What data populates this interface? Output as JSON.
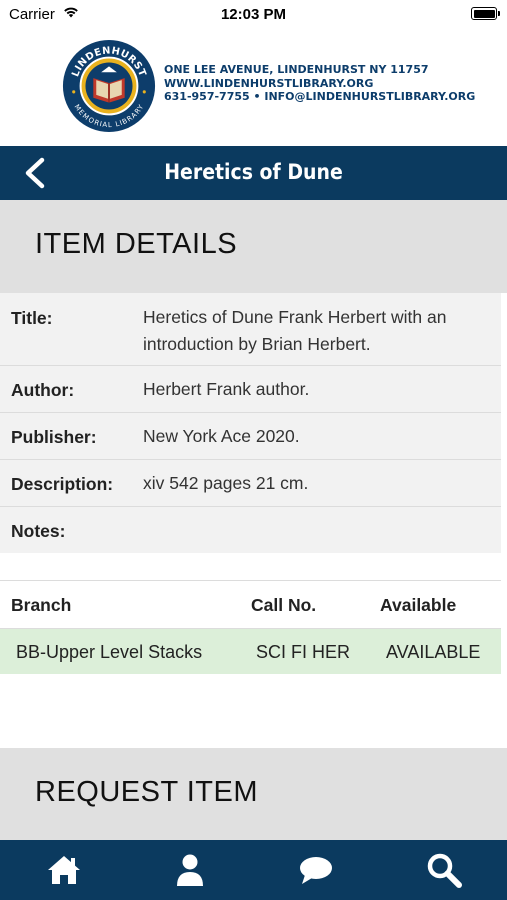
{
  "status_bar": {
    "carrier": "Carrier",
    "time": "12:03 PM"
  },
  "library": {
    "logo_text_top": "LINDENHURST",
    "logo_text_bottom": "MEMORIAL LIBRARY",
    "address": "ONE LEE AVENUE, LINDENHURST NY 11757",
    "website": "WWW.LINDENHURSTLIBRARY.ORG",
    "contact": "631-957-7755 • INFO@LINDENHURSTLIBRARY.ORG"
  },
  "navbar": {
    "title": "Heretics of Dune"
  },
  "item_details": {
    "heading": "ITEM DETAILS",
    "rows": [
      {
        "label": "Title:",
        "value": "Heretics of Dune Frank Herbert with an introduction by Brian Herbert."
      },
      {
        "label": "Author:",
        "value": "Herbert Frank author."
      },
      {
        "label": "Publisher:",
        "value": "New York Ace 2020."
      },
      {
        "label": "Description:",
        "value": "xiv 542 pages 21 cm."
      },
      {
        "label": "Notes:",
        "value": ""
      }
    ]
  },
  "availability": {
    "headers": {
      "branch": "Branch",
      "call_no": "Call No.",
      "available": "Available"
    },
    "rows": [
      {
        "branch": "BB-Upper Level Stacks",
        "call_no": "SCI FI HER",
        "available": "AVAILABLE"
      }
    ]
  },
  "request_item": {
    "heading": "REQUEST ITEM"
  },
  "tab_bar": {
    "icons": [
      "home-icon",
      "user-icon",
      "chat-icon",
      "search-icon"
    ]
  },
  "colors": {
    "navy": "#0b3a5f",
    "available_row": "#dcefd9",
    "section_bg": "#e0e0e0",
    "detail_bg": "#f2f2f2",
    "logo_gold": "#e9b21f"
  }
}
